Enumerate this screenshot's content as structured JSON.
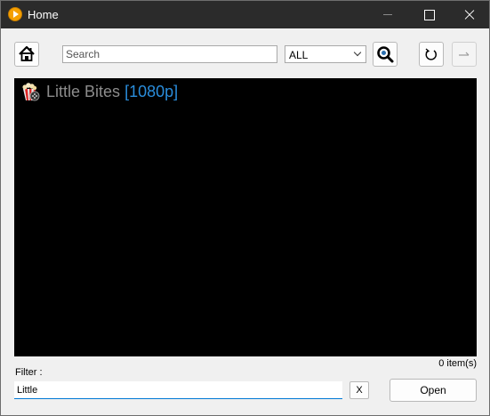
{
  "window": {
    "title": "Home",
    "accent": "#f5a000"
  },
  "toolbar": {
    "home_icon": "home-icon",
    "search_placeholder": "Search",
    "category_selected": "ALL",
    "search_icon": "magnifier-icon",
    "refresh_icon": "refresh-icon",
    "forward_icon": "forward-arrow-icon"
  },
  "list": {
    "background": "#000000",
    "items": [
      {
        "icon": "popcorn-movie-icon",
        "title": "Little Bites",
        "quality": "[1080p]",
        "title_color": "#8c8c8c",
        "quality_color": "#2a8ddb"
      }
    ],
    "count_label": "0 item(s)"
  },
  "filter": {
    "label": "Filter :",
    "value": "Little",
    "clear_label": "X"
  },
  "actions": {
    "open_label": "Open"
  }
}
